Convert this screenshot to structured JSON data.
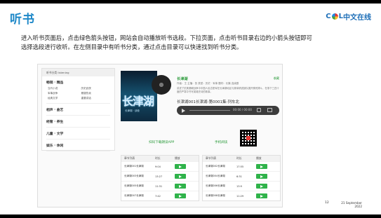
{
  "slide": {
    "title": "听书",
    "brand": {
      "c": "C",
      "l": "L",
      "text": "中文在线"
    },
    "paragraph": "进入听书页面后，点击绿色箭头按钮，网站会自动播放听书选段。下拉页面，点击听书目录右边的小箭头按钮即可选择选段进行收听。在左侧目录中有听书分类，通过点击目录可以快速找到听书分类。",
    "page_number": "12",
    "date": "21 September 2022"
  },
  "app": {
    "sidebar": {
      "header": "听书分类 listening",
      "categories": [
        {
          "label": "畅销 · 精品",
          "subs": [
            "当代小说",
            "历史武侠",
            "军事战争",
            "悬疑热卖",
            "经典文学",
            "重要讲话"
          ]
        },
        {
          "label": "相声 · 曲艺",
          "subs": []
        },
        {
          "label": "经管 · 养生",
          "subs": []
        },
        {
          "label": "儿童 · 文学",
          "subs": []
        },
        {
          "label": "娱乐 · 休闲",
          "subs": []
        }
      ]
    },
    "book": {
      "cover_title": "长津湖",
      "cover_subtitle": "长津湖 · 战役",
      "title": "长津湖",
      "collect": "收藏",
      "meta": "作者：王 主播：张 类型：历史 · 军事 题材：长篇 连续剧",
      "description": "讲述了抗美援朝战争中中国人民志愿军在长津湖地区与美军精锐部队展开殊死搏斗，在零下三四十度的严寒中书写英雄史诗的故事。"
    },
    "player": {
      "track_title": "长津湖001长津湖-第0001集-列车北",
      "time": "00:00 / 00:00"
    },
    "download_text": "扫码下载朗读APP",
    "read_text": "手机阅读",
    "tables": [
      {
        "headers": [
          "章节列表",
          "时长",
          "播放"
        ],
        "rows": [
          {
            "name": "长津湖001长津湖",
            "duration": "9:04"
          },
          {
            "name": "长津湖003长津湖",
            "duration": "13:27"
          },
          {
            "name": "长津湖005长津湖",
            "duration": "11:31"
          },
          {
            "name": "长津湖007长津湖",
            "duration": "7:42"
          }
        ]
      },
      {
        "headers": [
          "章节列表",
          "时长",
          "播放"
        ],
        "rows": [
          {
            "name": "长津湖002长津湖",
            "duration": "17:55"
          },
          {
            "name": "长津湖004长津湖",
            "duration": "6:31"
          },
          {
            "name": "长津湖006长津湖",
            "duration": "13:9"
          },
          {
            "name": "长津湖008长津湖",
            "duration": "11:29"
          }
        ]
      }
    ]
  },
  "colors": {
    "accent": "#1e88c8",
    "green": "#2fb34a"
  }
}
